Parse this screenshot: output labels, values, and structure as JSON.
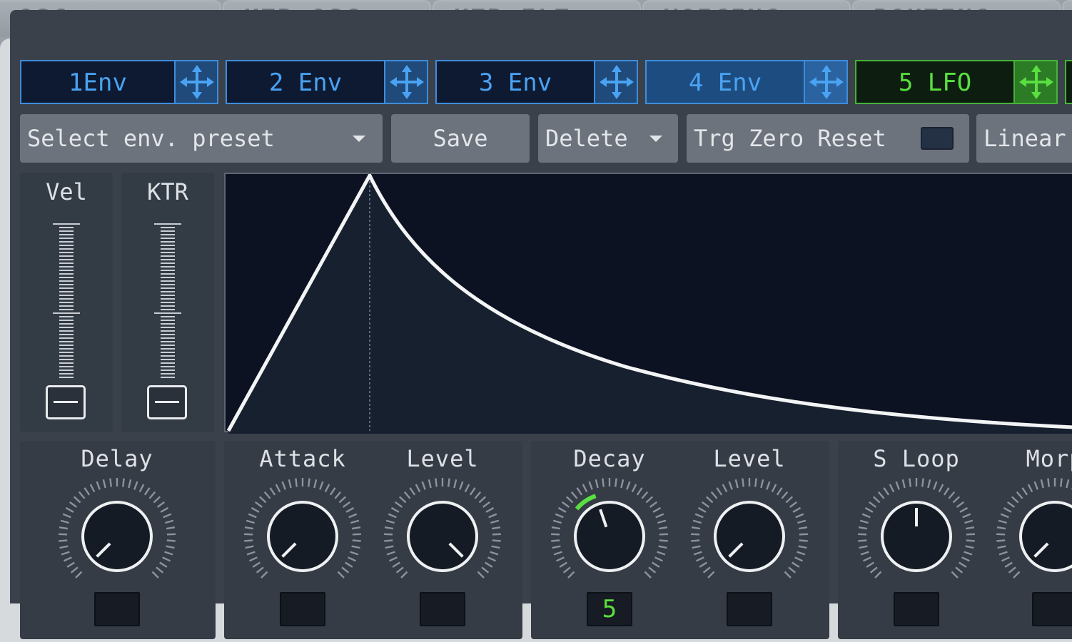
{
  "tabs": [
    "OSC",
    "KTR OSC",
    "KTR FLT",
    "VOICING",
    "ROUTING"
  ],
  "slots": [
    {
      "label": "1Env",
      "active": false,
      "kind": "env"
    },
    {
      "label": "2 Env",
      "active": false,
      "kind": "env"
    },
    {
      "label": "3 Env",
      "active": false,
      "kind": "env"
    },
    {
      "label": "4 Env",
      "active": true,
      "kind": "env"
    },
    {
      "label": "5 LFO",
      "active": false,
      "kind": "lfo"
    }
  ],
  "controls": {
    "preset": "Select env. preset",
    "save": "Save",
    "delete": "Delete",
    "trigger": "Trg Zero Reset",
    "curve": "Linear"
  },
  "sliders": [
    {
      "label": "Vel",
      "value": 0
    },
    {
      "label": "KTR",
      "value": 0
    }
  ],
  "knobs": [
    {
      "label": "Delay",
      "value": "",
      "position": 0.0
    },
    {
      "label": "Attack",
      "value": "",
      "position": 0.0
    },
    {
      "label": "Level",
      "value": "",
      "position": 1.0
    },
    {
      "label": "Decay",
      "value": "5",
      "position": 0.43
    },
    {
      "label": "Level",
      "value": "",
      "position": 0.0
    },
    {
      "label": "S Loop",
      "value": "",
      "position": 0.5
    },
    {
      "label": "Morp",
      "value": "",
      "position": 0.0
    }
  ],
  "colors": {
    "env_accent": "#4aa3f2",
    "lfo_accent": "#59e040",
    "value_green": "#5ce03c",
    "display_bg": "#0c1222"
  },
  "icons": {
    "slot_handle": "move-arrows-icon",
    "dropdown": "caret-down-icon"
  }
}
